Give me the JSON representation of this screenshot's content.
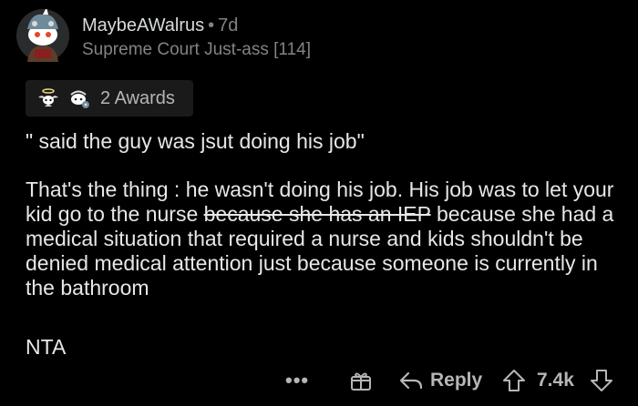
{
  "comment": {
    "username": "MaybeAWalrus",
    "separator": "•",
    "age": "7d",
    "flair": "Supreme Court Just-ass [114]",
    "awards": {
      "label": "2 Awards",
      "icons": [
        "angel-award-icon",
        "wholesome-award-icon"
      ]
    },
    "paragraphs": {
      "p1": "\" said the guy was jsut doing his job\"",
      "p2_before": "That's the thing : he wasn't doing his job. His job was to let your kid go to the nurse ",
      "p2_strike": "because she has an IEP",
      "p2_after": " because she had a medical situation that required a nurse and kids shouldn't be denied medical attention just because someone is currently in the bathroom",
      "p3": "NTA"
    }
  },
  "actions": {
    "more": "•••",
    "reply_label": "Reply",
    "score": "7.4k"
  },
  "colors": {
    "background": "#000000",
    "text_primary": "#e6e7e8",
    "text_muted": "#818384",
    "awards_bg": "#1a1a1b"
  }
}
